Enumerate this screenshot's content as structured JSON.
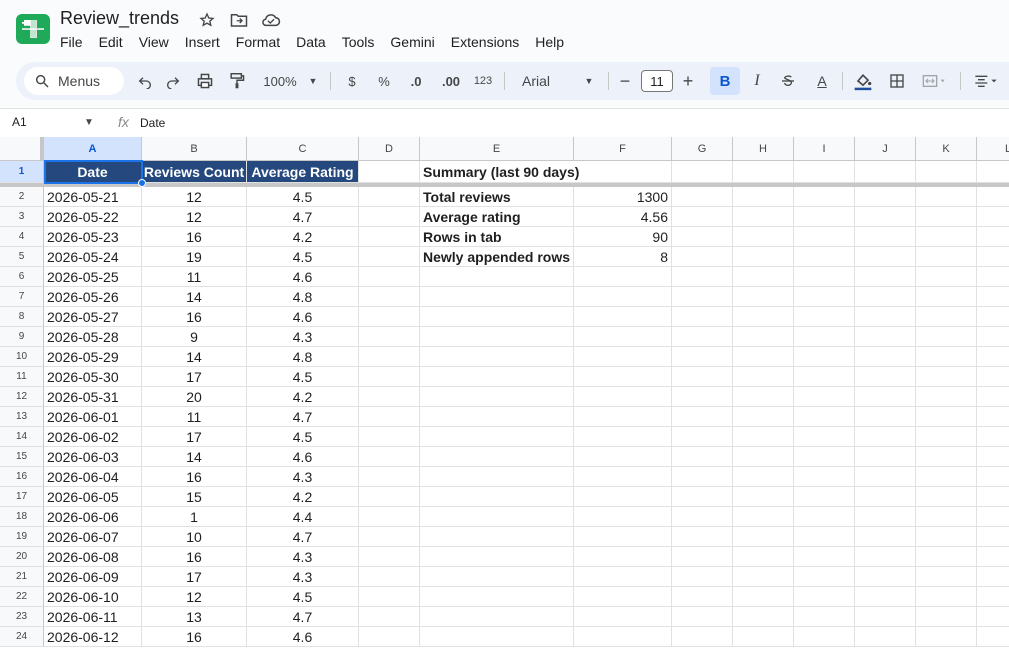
{
  "app": {
    "doc_title": "Review_trends",
    "menu": [
      "File",
      "Edit",
      "View",
      "Insert",
      "Format",
      "Data",
      "Tools",
      "Gemini",
      "Extensions",
      "Help"
    ]
  },
  "toolbar": {
    "menus_label": "Menus",
    "zoom": "100%",
    "currency": "$",
    "percent": "%",
    "dec_decrease": ".0",
    "dec_increase": ".00",
    "number_format": "123",
    "font": "Arial",
    "font_size": "11",
    "bold": "B",
    "italic": "I",
    "text_color": "A"
  },
  "formula_bar": {
    "name_box": "A1",
    "fx": "fx",
    "value": "Date"
  },
  "columns": [
    "A",
    "B",
    "C",
    "D",
    "E",
    "F",
    "G",
    "H",
    "I",
    "J",
    "K",
    "L"
  ],
  "headers": [
    "Date",
    "Reviews Count",
    "Average Rating"
  ],
  "rows": [
    {
      "date": "2026-05-21",
      "count": "12",
      "rating": "4.5"
    },
    {
      "date": "2026-05-22",
      "count": "12",
      "rating": "4.7"
    },
    {
      "date": "2026-05-23",
      "count": "16",
      "rating": "4.2"
    },
    {
      "date": "2026-05-24",
      "count": "19",
      "rating": "4.5"
    },
    {
      "date": "2026-05-25",
      "count": "11",
      "rating": "4.6"
    },
    {
      "date": "2026-05-26",
      "count": "14",
      "rating": "4.8"
    },
    {
      "date": "2026-05-27",
      "count": "16",
      "rating": "4.6"
    },
    {
      "date": "2026-05-28",
      "count": "9",
      "rating": "4.3"
    },
    {
      "date": "2026-05-29",
      "count": "14",
      "rating": "4.8"
    },
    {
      "date": "2026-05-30",
      "count": "17",
      "rating": "4.5"
    },
    {
      "date": "2026-05-31",
      "count": "20",
      "rating": "4.2"
    },
    {
      "date": "2026-06-01",
      "count": "11",
      "rating": "4.7"
    },
    {
      "date": "2026-06-02",
      "count": "17",
      "rating": "4.5"
    },
    {
      "date": "2026-06-03",
      "count": "14",
      "rating": "4.6"
    },
    {
      "date": "2026-06-04",
      "count": "16",
      "rating": "4.3"
    },
    {
      "date": "2026-06-05",
      "count": "15",
      "rating": "4.2"
    },
    {
      "date": "2026-06-06",
      "count": "1",
      "rating": "4.4"
    },
    {
      "date": "2026-06-07",
      "count": "10",
      "rating": "4.7"
    },
    {
      "date": "2026-06-08",
      "count": "16",
      "rating": "4.3"
    },
    {
      "date": "2026-06-09",
      "count": "17",
      "rating": "4.3"
    },
    {
      "date": "2026-06-10",
      "count": "12",
      "rating": "4.5"
    },
    {
      "date": "2026-06-11",
      "count": "13",
      "rating": "4.7"
    },
    {
      "date": "2026-06-12",
      "count": "16",
      "rating": "4.6"
    }
  ],
  "summary": {
    "title": "Summary (last 90 days)",
    "items": [
      {
        "label": "Total reviews",
        "value": "1300"
      },
      {
        "label": "Average rating",
        "value": "4.56"
      },
      {
        "label": "Rows in tab",
        "value": "90"
      },
      {
        "label": "Newly appended rows",
        "value": "8"
      }
    ]
  },
  "colors": {
    "header_fill": "#25497e",
    "selection": "#1a73e8",
    "logo": "#1faa59"
  }
}
